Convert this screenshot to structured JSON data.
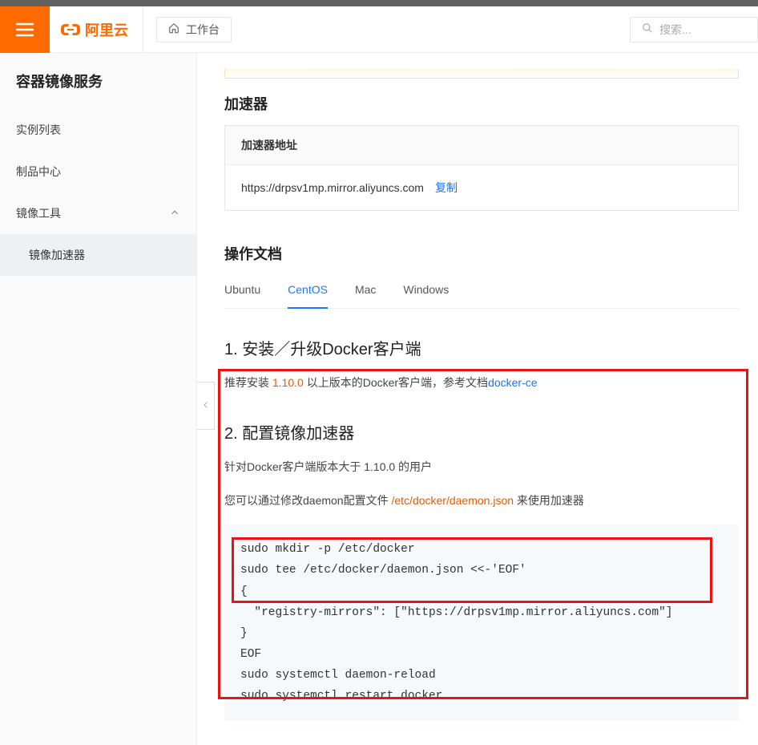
{
  "topbar": {
    "brand": "阿里云",
    "workbench": "工作台",
    "search_placeholder": "搜索..."
  },
  "sidebar": {
    "title": "容器镜像服务",
    "items": [
      {
        "label": "实例列表"
      },
      {
        "label": "制品中心"
      },
      {
        "label": "镜像工具",
        "expanded": true
      }
    ],
    "sub": "镜像加速器"
  },
  "accel": {
    "section": "加速器",
    "card_title": "加速器地址",
    "url": "https://drpsv1mp.mirror.aliyuncs.com",
    "copy": "复制"
  },
  "docs": {
    "title": "操作文档",
    "tabs": [
      {
        "label": "Ubuntu"
      },
      {
        "label": "CentOS",
        "active": true
      },
      {
        "label": "Mac"
      },
      {
        "label": "Windows"
      }
    ],
    "step1_title": "1. 安装／升级Docker客户端",
    "step1_line_a": "推荐安装 ",
    "step1_version": "1.10.0",
    "step1_line_b": " 以上版本的Docker客户端，参考文档",
    "step1_link": "docker-ce",
    "step2_title": "2. 配置镜像加速器",
    "step2_p1": "针对Docker客户端版本大于 1.10.0 的用户",
    "step2_p2a": "您可以通过修改daemon配置文件 ",
    "step2_path": "/etc/docker/daemon.json",
    "step2_p2b": " 来使用加速器",
    "code": "sudo mkdir -p /etc/docker\nsudo tee /etc/docker/daemon.json <<-'EOF'\n{\n  \"registry-mirrors\": [\"https://drpsv1mp.mirror.aliyuncs.com\"]\n}\nEOF\nsudo systemctl daemon-reload\nsudo systemctl restart docker"
  }
}
